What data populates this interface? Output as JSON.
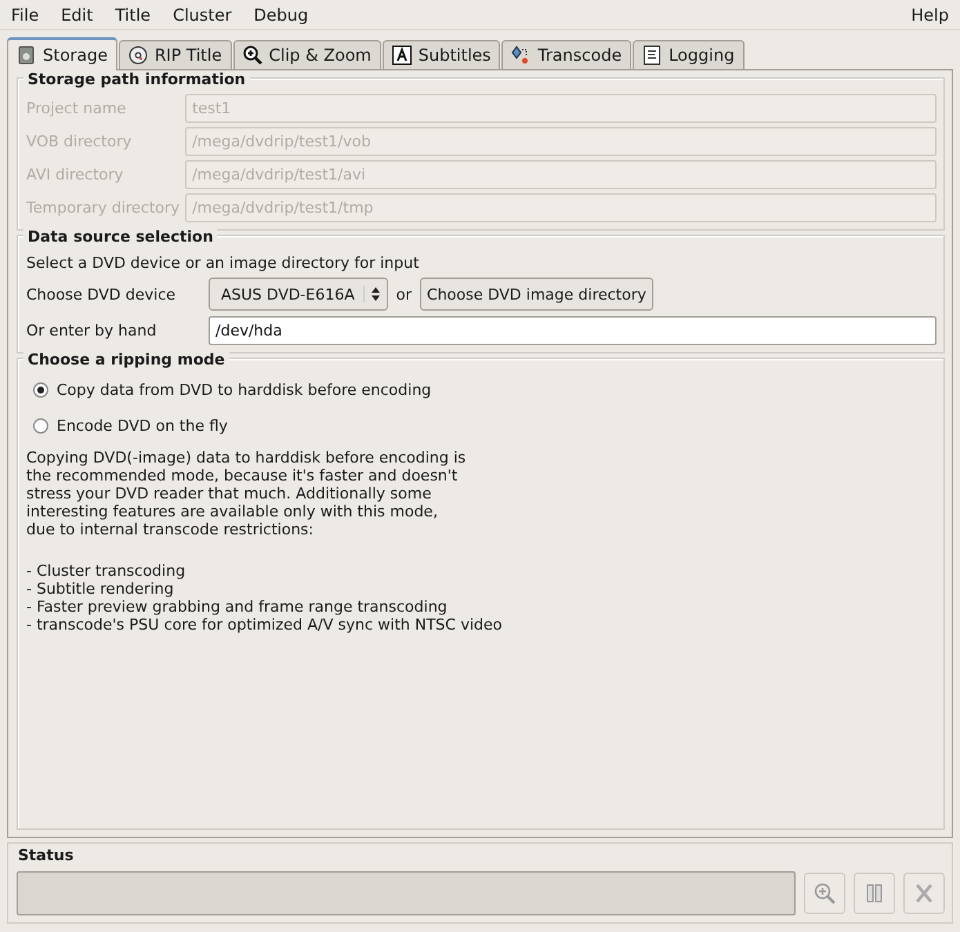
{
  "menu_bar": {
    "left": [
      "File",
      "Edit",
      "Title",
      "Cluster",
      "Debug"
    ],
    "right": [
      "Help"
    ]
  },
  "tabs": [
    {
      "label": "Storage",
      "kind": "storage",
      "selected": true
    },
    {
      "label": "RIP Title",
      "kind": "disc",
      "selected": false
    },
    {
      "label": "Clip & Zoom",
      "kind": "zoom",
      "selected": false
    },
    {
      "label": "Subtitles",
      "kind": "subtitles",
      "selected": false
    },
    {
      "label": "Transcode",
      "kind": "transcode",
      "selected": false
    },
    {
      "label": "Logging",
      "kind": "log",
      "selected": false
    }
  ],
  "storage": {
    "title": "Storage path information",
    "fields": [
      {
        "label": "Project name",
        "value": "test1",
        "disabled": true
      },
      {
        "label": "VOB directory",
        "value": "/mega/dvdrip/test1/vob",
        "disabled": true
      },
      {
        "label": "AVI directory",
        "value": "/mega/dvdrip/test1/avi",
        "disabled": true
      },
      {
        "label": "Temporary directory",
        "value": "/mega/dvdrip/test1/tmp",
        "disabled": true
      }
    ]
  },
  "data_source": {
    "title": "Data source selection",
    "hint": "Select a DVD device or an image directory for input",
    "device_label": "Choose DVD device",
    "device_value": "ASUS DVD-E616A",
    "or": "or",
    "image_button": "Choose DVD image directory",
    "hand_label": "Or enter by hand",
    "hand_value": "/dev/hda"
  },
  "ripping_mode": {
    "title": "Choose a ripping mode",
    "options": [
      {
        "label": "Copy data from DVD to harddisk before encoding",
        "selected": true
      },
      {
        "label": "Encode DVD on the fly",
        "selected": false
      }
    ],
    "description": "Copying DVD(-image) data to harddisk before encoding is\nthe recommended mode, because it's faster and doesn't\nstress your DVD reader that much. Additionally some\ninteresting features are available only with this mode,\ndue to internal transcode restrictions:",
    "features": [
      "- Cluster transcoding",
      "- Subtitle rendering",
      "- Faster preview grabbing and frame range transcoding",
      "- transcode's PSU core for optimized A/V sync with NTSC video"
    ]
  },
  "status": {
    "title": "Status"
  }
}
